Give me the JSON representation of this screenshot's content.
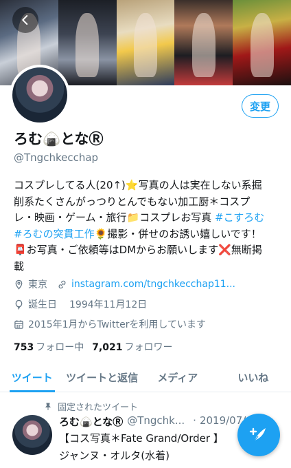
{
  "profile": {
    "edit_label": "変更",
    "display_name": "ろむ🍙となⓇ",
    "handle": "@Tngchkecchap",
    "bio": {
      "line1": "コスプレしてる人(20↑)⭐写真の人は実在しない系掘",
      "line2": "削系たくさんがっつりとんでもない加工厨＊コスプ",
      "line3_a": "レ・映画・ゲーム・旅行📁コスプレお写真 ",
      "hashtag1": "#こすろむ",
      "hashtag2": "#ろむの突貫工作",
      "line4_b": "🌻撮影・併せのお誘い嬉しいです！",
      "line5": "📮お写真・ご依頼等はDMからお願いします❌無断掲",
      "line6": "載"
    },
    "location": "東京",
    "website": "instagram.com/tngchkecchap11...",
    "birth_label": "誕生日",
    "birth_date": "1994年11月12日",
    "joined": "2015年1月からTwitterを利用しています",
    "following_count": "753",
    "following_label": "フォロー中",
    "followers_count": "7,021",
    "followers_label": "フォロワー"
  },
  "tabs": [
    {
      "label": "ツイート",
      "active": true
    },
    {
      "label": "ツイートと返信",
      "active": false
    },
    {
      "label": "メディア",
      "active": false
    },
    {
      "label": "いいね",
      "active": false
    }
  ],
  "pinned_tweet": {
    "pinned_label": "固定されたツイート",
    "name": "ろむ🍙となⓇ",
    "handle": "@Tngchk...",
    "date": "2019/07/",
    "line1": "【コス写真＊Fate Grand/Order 】",
    "line2": "ジャンヌ・オルタ(水着)"
  },
  "colors": {
    "accent": "#1da1f2",
    "secondary_text": "#657786",
    "primary_text": "#14171a"
  },
  "icons": {
    "back": "chevron-left-icon",
    "location": "location-pin-icon",
    "link": "link-icon",
    "birthday": "balloon-icon",
    "calendar": "calendar-icon",
    "pin": "pin-icon",
    "compose": "feather-plus-icon"
  }
}
